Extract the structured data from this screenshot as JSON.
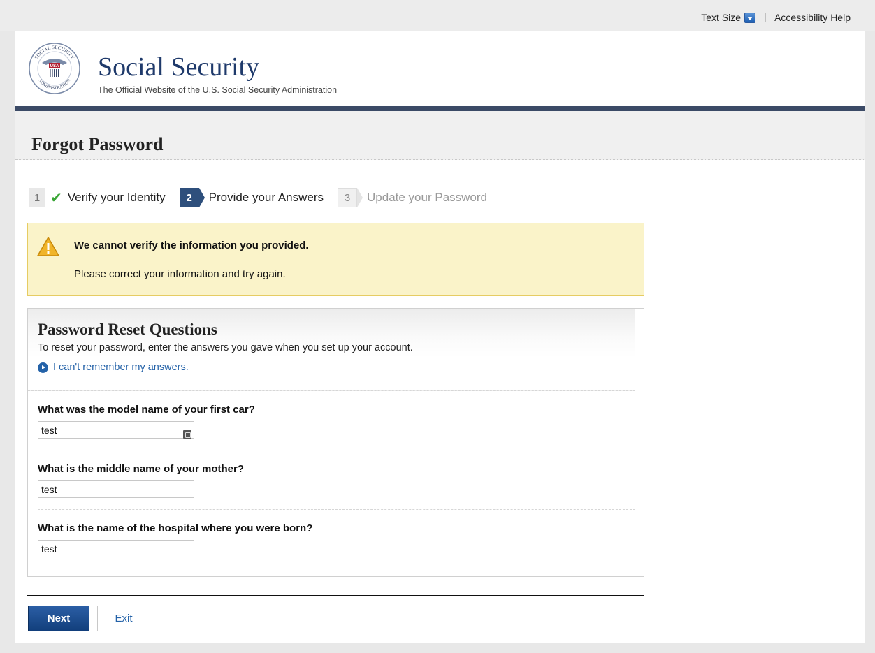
{
  "utility": {
    "text_size_label": "Text Size",
    "accessibility_label": "Accessibility Help"
  },
  "header": {
    "site_title": "Social Security",
    "tagline": "The Official Website of the U.S. Social Security Administration",
    "seal_text_top": "SOCIAL SECURITY",
    "seal_text_bottom": "ADMINISTRATION",
    "seal_center": "USA"
  },
  "page": {
    "title": "Forgot Password"
  },
  "stepper": {
    "steps": [
      {
        "number": "1",
        "label": "Verify your Identity",
        "state": "done"
      },
      {
        "number": "2",
        "label": "Provide your Answers",
        "state": "active"
      },
      {
        "number": "3",
        "label": "Update your Password",
        "state": "pending"
      }
    ]
  },
  "alert": {
    "title": "We cannot verify the information you provided.",
    "message": "Please correct your information and try again."
  },
  "panel": {
    "title": "Password Reset Questions",
    "description": "To reset your password, enter the answers you gave when you set up your account.",
    "help_link": "I can't remember my answers.",
    "questions": [
      {
        "label": "What was the model name of your first car?",
        "value": "test"
      },
      {
        "label": "What is the middle name of your mother?",
        "value": "test"
      },
      {
        "label": "What is the name of the hospital where you were born?",
        "value": "test"
      }
    ]
  },
  "actions": {
    "next_label": "Next",
    "exit_label": "Exit"
  },
  "colors": {
    "brand_navy": "#1f3a6b",
    "alert_bg": "#faf3c9",
    "link_blue": "#2462a8",
    "step_active": "#2e4f7c"
  }
}
